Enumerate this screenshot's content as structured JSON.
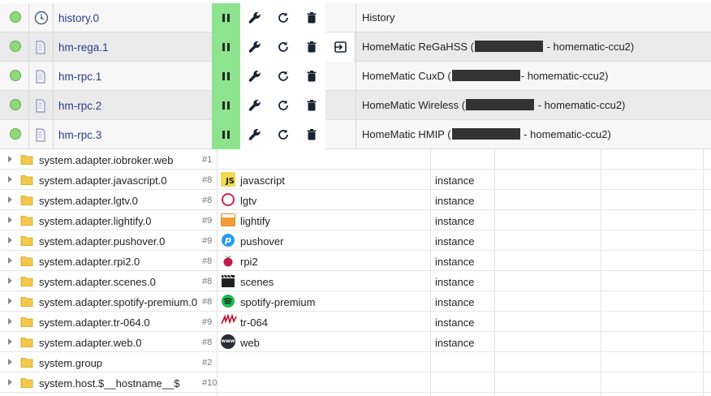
{
  "instances": [
    {
      "name": "history.0",
      "title_pre": "History",
      "title_post": "",
      "redacted": false,
      "icon": "history-clock-icon",
      "extra": false
    },
    {
      "name": "hm-rega.1",
      "title_pre": "HomeMatic ReGaHSS (",
      "title_post": " - homematic-ccu2)",
      "redacted": true,
      "icon": "hm-building-icon",
      "extra": true
    },
    {
      "name": "hm-rpc.1",
      "title_pre": "HomeMatic CuxD (",
      "title_post": "- homematic-ccu2)",
      "redacted": true,
      "icon": "hm-building-icon",
      "extra": false
    },
    {
      "name": "hm-rpc.2",
      "title_pre": "HomeMatic Wireless (",
      "title_post": " - homematic-ccu2)",
      "redacted": true,
      "icon": "hm-building-icon",
      "extra": false
    },
    {
      "name": "hm-rpc.3",
      "title_pre": "HomeMatic HMIP (",
      "title_post": " - homematic-ccu2)",
      "redacted": true,
      "icon": "hm-building-icon",
      "extra": false
    }
  ],
  "objects": [
    {
      "name": "system.adapter.iobroker.web",
      "count": "#1",
      "adapter": "",
      "type": "",
      "icon": ""
    },
    {
      "name": "system.adapter.javascript.0",
      "count": "#8",
      "adapter": "javascript",
      "type": "instance",
      "icon": "javascript-icon"
    },
    {
      "name": "system.adapter.lgtv.0",
      "count": "#8",
      "adapter": "lgtv",
      "type": "instance",
      "icon": "lgtv-icon"
    },
    {
      "name": "system.adapter.lightify.0",
      "count": "#9",
      "adapter": "lightify",
      "type": "instance",
      "icon": "lightify-icon"
    },
    {
      "name": "system.adapter.pushover.0",
      "count": "#9",
      "adapter": "pushover",
      "type": "instance",
      "icon": "pushover-icon"
    },
    {
      "name": "system.adapter.rpi2.0",
      "count": "#8",
      "adapter": "rpi2",
      "type": "instance",
      "icon": "raspberry-icon"
    },
    {
      "name": "system.adapter.scenes.0",
      "count": "#8",
      "adapter": "scenes",
      "type": "instance",
      "icon": "clapperboard-icon"
    },
    {
      "name": "system.adapter.spotify-premium.0",
      "count": "#8",
      "adapter": "spotify-premium",
      "type": "instance",
      "icon": "spotify-icon"
    },
    {
      "name": "system.adapter.tr-064.0",
      "count": "#9",
      "adapter": "tr-064",
      "type": "instance",
      "icon": "avm-icon"
    },
    {
      "name": "system.adapter.web.0",
      "count": "#8",
      "adapter": "web",
      "type": "instance",
      "icon": "web-icon"
    },
    {
      "name": "system.group",
      "count": "#2",
      "adapter": "",
      "type": "",
      "icon": ""
    },
    {
      "name": "system.host.$__hostname__$",
      "count": "#10",
      "adapter": "",
      "type": "",
      "icon": ""
    }
  ],
  "colors": {
    "status_ok": "#8fd97a",
    "pause_bg": "#8ee38e",
    "link": "#2c3a8c",
    "redaction": "#333333"
  },
  "icons": {
    "pause": "pause-icon",
    "settings": "wrench-icon",
    "restart": "reload-icon",
    "delete": "trash-icon",
    "open": "open-in-icon",
    "folder": "folder-icon",
    "expand": "caret-right-icon"
  }
}
